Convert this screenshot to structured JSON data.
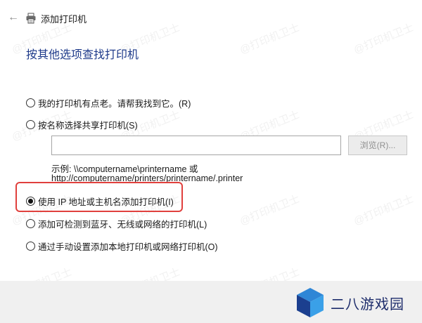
{
  "titlebar": {
    "back_glyph": "←",
    "title": "添加打印机",
    "icon": "printer-icon"
  },
  "heading": "按其他选项查找打印机",
  "options": [
    {
      "label": "我的打印机有点老。请帮我找到它。(R)",
      "checked": false
    },
    {
      "label": "按名称选择共享打印机(S)",
      "checked": false
    },
    {
      "label": "使用 IP 地址或主机名添加打印机(I)",
      "checked": true
    },
    {
      "label": "添加可检测到蓝牙、无线或网络的打印机(L)",
      "checked": false
    },
    {
      "label": "通过手动设置添加本地打印机或网络打印机(O)",
      "checked": false
    }
  ],
  "share": {
    "input_value": "",
    "browse_label": "浏览(R)...",
    "example_line1": "示例: \\\\computername\\printername 或",
    "example_line2": "http://computername/printers/printername/.printer"
  },
  "watermark_text": "@打印机卫士",
  "brand": {
    "name": "二八游戏园",
    "colors": {
      "top": "#2f86d6",
      "left": "#1b3f8f",
      "right": "#3aa0e8"
    }
  },
  "colors": {
    "heading": "#1e3a8a",
    "highlight": "#e0403d"
  }
}
